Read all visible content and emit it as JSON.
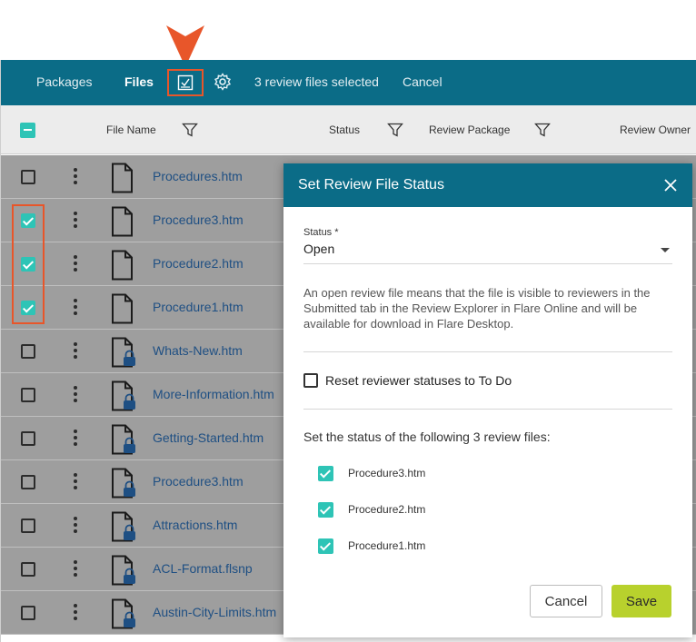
{
  "topbar": {
    "tabs": [
      {
        "label": "Packages"
      },
      {
        "label": "Files"
      }
    ],
    "selection_text": "3 review files selected",
    "cancel_label": "Cancel"
  },
  "columns": {
    "file_name": "File Name",
    "status": "Status",
    "review_package": "Review Package",
    "review_owner": "Review Owner"
  },
  "files": [
    {
      "name": "Procedures.htm",
      "checked": false,
      "locked": false
    },
    {
      "name": "Procedure3.htm",
      "checked": true,
      "locked": false
    },
    {
      "name": "Procedure2.htm",
      "checked": true,
      "locked": false
    },
    {
      "name": "Procedure1.htm",
      "checked": true,
      "locked": false
    },
    {
      "name": "Whats-New.htm",
      "checked": false,
      "locked": true
    },
    {
      "name": "More-Information.htm",
      "checked": false,
      "locked": true
    },
    {
      "name": "Getting-Started.htm",
      "checked": false,
      "locked": true
    },
    {
      "name": "Procedure3.htm",
      "checked": false,
      "locked": true
    },
    {
      "name": "Attractions.htm",
      "checked": false,
      "locked": true
    },
    {
      "name": "ACL-Format.flsnp",
      "checked": false,
      "locked": true
    },
    {
      "name": "Austin-City-Limits.htm",
      "checked": false,
      "locked": true
    }
  ],
  "dialog": {
    "title": "Set Review File Status",
    "status_label": "Status *",
    "status_value": "Open",
    "description": "An open review file means that the file is visible to reviewers in the Submitted tab in the Review Explorer in Flare Online and will be available for download in Flare Desktop.",
    "reset_label": "Reset reviewer statuses to To Do",
    "list_title": "Set the status of the following 3 review files:",
    "selected_files": [
      "Procedure3.htm",
      "Procedure2.htm",
      "Procedure1.htm"
    ],
    "cancel_label": "Cancel",
    "save_label": "Save"
  },
  "colors": {
    "header": "#0b6c87",
    "accent": "#2ec4b6",
    "save": "#b8d12d",
    "callout": "#e8562a",
    "link": "#1e4f83"
  }
}
